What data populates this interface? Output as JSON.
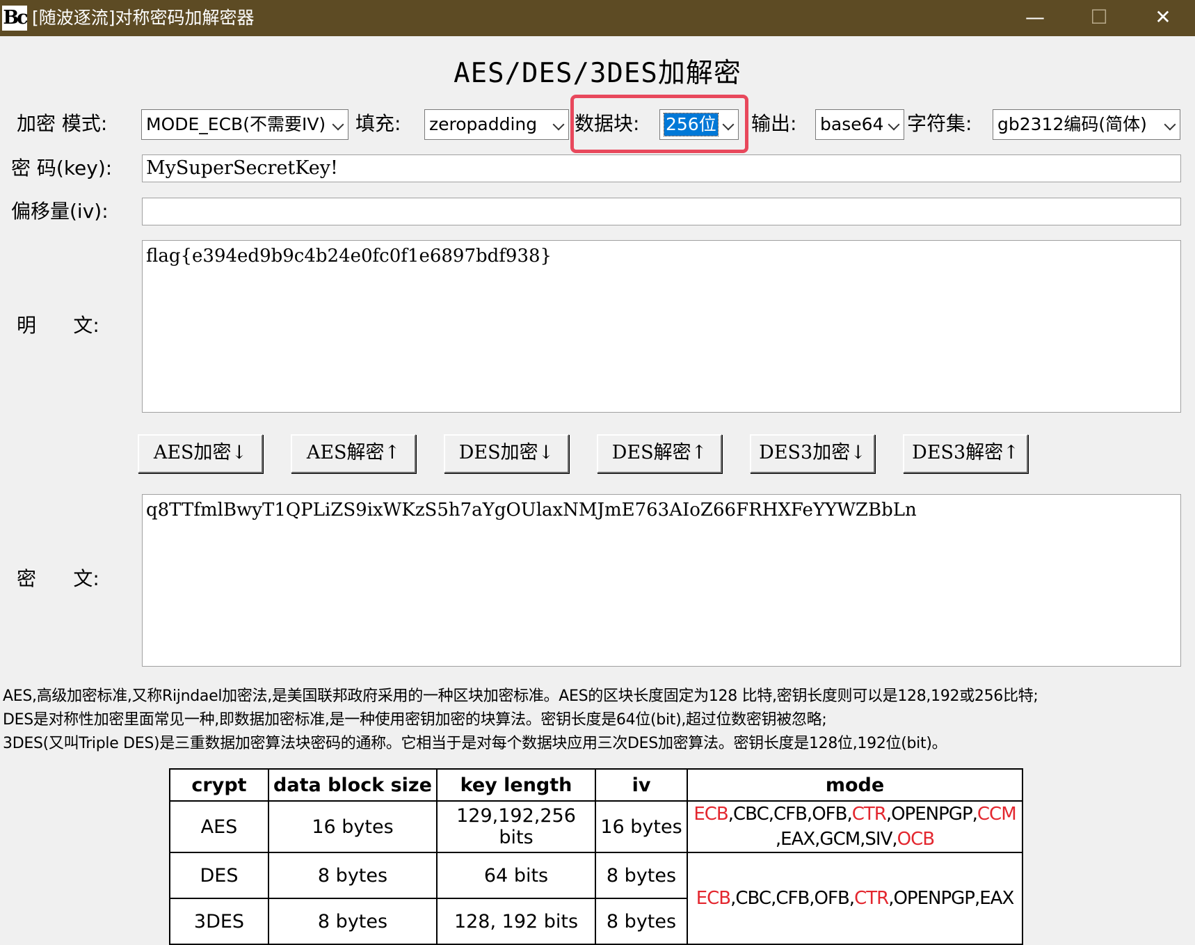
{
  "window": {
    "icon_text": "Bc",
    "title": "[随波逐流]对称密码加解密器",
    "minimize_glyph": "—",
    "maximize_glyph": "☐",
    "close_glyph": "✕"
  },
  "heading": "AES/DES/3DES加解密",
  "options": {
    "mode_label": "加密 模式:",
    "mode_value": "MODE_ECB(不需要IV)",
    "padding_label": "填充:",
    "padding_value": "zeropadding",
    "block_label": "数据块:",
    "block_value": "256位",
    "output_label": "输出:",
    "output_value": "base64",
    "charset_label": "字符集:",
    "charset_value": "gb2312编码(简体)"
  },
  "key": {
    "label": "密 码(key):",
    "value": "MySuperSecretKey!"
  },
  "iv": {
    "label": "偏移量(iv):",
    "value": ""
  },
  "plaintext": {
    "label": "明      文:",
    "value": "flag{e394ed9b9c4b24e0fc0f1e6897bdf938}"
  },
  "buttons": {
    "aes_encrypt": "AES加密↓",
    "aes_decrypt": "AES解密↑",
    "des_encrypt": "DES加密↓",
    "des_decrypt": "DES解密↑",
    "des3_encrypt": "DES3加密↓",
    "des3_decrypt": "DES3解密↑"
  },
  "ciphertext": {
    "label": "密      文:",
    "value": "q8TTfmlBwyT1QPLiZS9ixWKzS5h7aYgOUlaxNMJmE763AIoZ66FRHXFeYYWZBbLn"
  },
  "description": [
    "AES,高级加密标准,又称Rijndael加密法,是美国联邦政府采用的一种区块加密标准。AES的区块长度固定为128 比特,密钥长度则可以是128,192或256比特;",
    "DES是对称性加密里面常见一种,即数据加密标准,是一种使用密钥加密的块算法。密钥长度是64位(bit),超过位数密钥被忽略;",
    "3DES(又叫Triple DES)是三重数据加密算法块密码的通称。它相当于是对每个数据块应用三次DES加密算法。密钥长度是128位,192位(bit)。"
  ],
  "table": {
    "headers": [
      "crypt",
      "data block size",
      "key length",
      "iv",
      "mode"
    ],
    "rows": [
      {
        "crypt": "AES",
        "block": "16 bytes",
        "key": "129,192,256 bits",
        "iv": "16 bytes"
      },
      {
        "crypt": "DES",
        "block": "8 bytes",
        "key": "64 bits",
        "iv": "8 bytes"
      },
      {
        "crypt": "3DES",
        "block": "8 bytes",
        "key": "128, 192 bits",
        "iv": "8 bytes"
      }
    ],
    "aes_modes": {
      "ecb": "ECB",
      "part1": ",CBC,CFB,OFB,",
      "ctr": "CTR",
      "part2": ",OPENPGP,",
      "ccm": "CCM",
      "part3": ",EAX,GCM,SIV,",
      "ocb": "OCB"
    },
    "des_modes": {
      "ecb": "ECB",
      "part1": ",CBC,CFB,OFB,",
      "ctr": "CTR",
      "part2": ",OPENPGP,EAX"
    },
    "highlight_color": "#e3262e"
  }
}
